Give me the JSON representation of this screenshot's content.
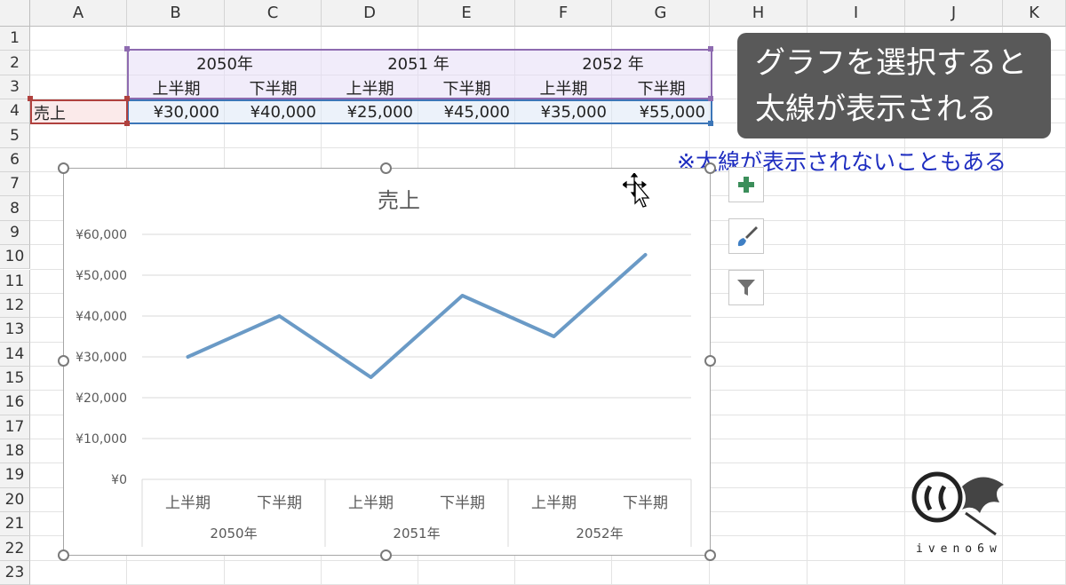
{
  "columns": [
    "A",
    "B",
    "C",
    "D",
    "E",
    "F",
    "G",
    "H",
    "I",
    "J",
    "K"
  ],
  "rows": [
    "1",
    "2",
    "3",
    "4",
    "5",
    "6",
    "7",
    "8",
    "9",
    "10",
    "11",
    "12",
    "13",
    "14",
    "15",
    "16",
    "17",
    "18",
    "19",
    "20",
    "21",
    "22",
    "23"
  ],
  "table": {
    "years": [
      "2050年",
      "2051 年",
      "2052 年"
    ],
    "halves": [
      "上半期",
      "下半期",
      "上半期",
      "下半期",
      "上半期",
      "下半期"
    ],
    "row_label": "売上",
    "values": [
      "¥30,000",
      "¥40,000",
      "¥25,000",
      "¥45,000",
      "¥35,000",
      "¥55,000"
    ]
  },
  "callout": {
    "line1": "グラフを選択すると",
    "line2": "太線が表示される",
    "background": "#595959"
  },
  "note": "※太線が表示されないこともある",
  "side_buttons": {
    "plus_icon": "plus-icon",
    "brush_icon": "brush-icon",
    "filter_icon": "filter-icon"
  },
  "chart_data": {
    "type": "line",
    "title": "売上",
    "categories": [
      "上半期",
      "下半期",
      "上半期",
      "下半期",
      "上半期",
      "下半期"
    ],
    "groups": [
      "2050年",
      "2051年",
      "2052年"
    ],
    "series": [
      {
        "values": [
          30000,
          40000,
          25000,
          45000,
          35000,
          55000
        ],
        "color": "#6a9ac6"
      }
    ],
    "ylim": [
      0,
      60000
    ],
    "yticks": [
      "¥0",
      "¥10,000",
      "¥20,000",
      "¥30,000",
      "¥40,000",
      "¥50,000",
      "¥60,000"
    ],
    "grid": true,
    "legend": "none"
  },
  "watermark": "iveno6w"
}
